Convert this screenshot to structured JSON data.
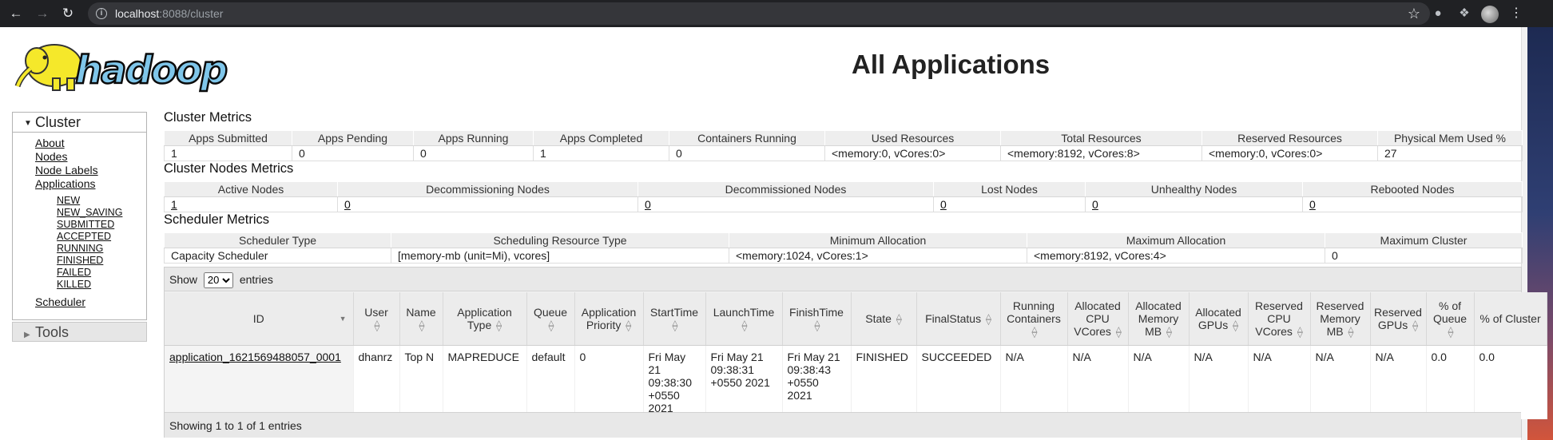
{
  "browser": {
    "url_host": "localhost",
    "url_rest": ":8088/cluster"
  },
  "page": {
    "title": "All Applications"
  },
  "sidebar": {
    "cluster_heading": "Cluster",
    "links": [
      "About",
      "Nodes",
      "Node Labels",
      "Applications"
    ],
    "states": [
      "NEW",
      "NEW_SAVING",
      "SUBMITTED",
      "ACCEPTED",
      "RUNNING",
      "FINISHED",
      "FAILED",
      "KILLED"
    ],
    "scheduler": "Scheduler",
    "tools": "Tools"
  },
  "cluster_metrics": {
    "title": "Cluster Metrics",
    "headers": [
      "Apps Submitted",
      "Apps Pending",
      "Apps Running",
      "Apps Completed",
      "Containers Running",
      "Used Resources",
      "Total Resources",
      "Reserved Resources",
      "Physical Mem Used %"
    ],
    "values": [
      "1",
      "0",
      "0",
      "1",
      "0",
      "<memory:0, vCores:0>",
      "<memory:8192, vCores:8>",
      "<memory:0, vCores:0>",
      "27"
    ]
  },
  "nodes_metrics": {
    "title": "Cluster Nodes Metrics",
    "headers": [
      "Active Nodes",
      "Decommissioning Nodes",
      "Decommissioned Nodes",
      "Lost Nodes",
      "Unhealthy Nodes",
      "Rebooted Nodes"
    ],
    "values": [
      "1",
      "0",
      "0",
      "0",
      "0",
      "0"
    ]
  },
  "scheduler_metrics": {
    "title": "Scheduler Metrics",
    "headers": [
      "Scheduler Type",
      "Scheduling Resource Type",
      "Minimum Allocation",
      "Maximum Allocation",
      "Maximum Cluster"
    ],
    "values": [
      "Capacity Scheduler",
      "[memory-mb (unit=Mi), vcores]",
      "<memory:1024, vCores:1>",
      "<memory:8192, vCores:4>",
      "0"
    ]
  },
  "apps_table": {
    "show_label": "Show",
    "entries_label": "entries",
    "page_size": "20",
    "headers": [
      "ID",
      "User",
      "Name",
      "Application Type",
      "Queue",
      "Application Priority",
      "StartTime",
      "LaunchTime",
      "FinishTime",
      "State",
      "FinalStatus",
      "Running Containers",
      "Allocated CPU VCores",
      "Allocated Memory MB",
      "Allocated GPUs",
      "Reserved CPU VCores",
      "Reserved Memory MB",
      "Reserved GPUs",
      "% of Queue",
      "% of Cluster"
    ],
    "rows": [
      [
        "application_1621569488057_0001",
        "dhanrz",
        "Top N",
        "MAPREDUCE",
        "default",
        "0",
        "Fri May 21 09:38:30 +0550 2021",
        "Fri May 21 09:38:31 +0550 2021",
        "Fri May 21 09:38:43 +0550 2021",
        "FINISHED",
        "SUCCEEDED",
        "N/A",
        "N/A",
        "N/A",
        "N/A",
        "N/A",
        "N/A",
        "N/A",
        "0.0",
        "0.0"
      ]
    ],
    "info": "Showing 1 to 1 of 1 entries"
  }
}
